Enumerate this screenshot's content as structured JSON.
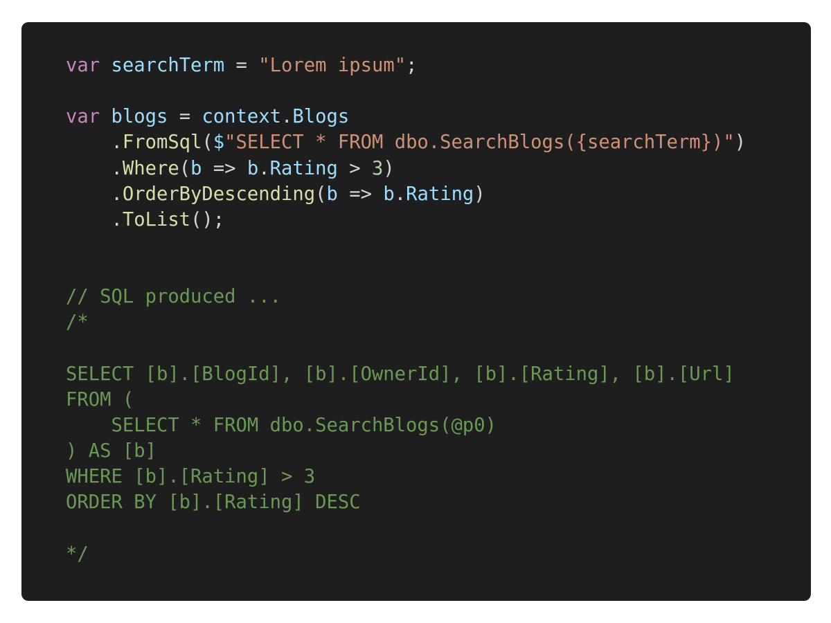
{
  "colors": {
    "background": "#1e1e1e",
    "page": "#ffffff",
    "keyword": "#c586c0",
    "variable": "#9cdcfe",
    "function": "#dcdcaa",
    "string": "#ce9178",
    "number": "#b5cea8",
    "plain": "#d4d4d4",
    "comment": "#6a9955"
  },
  "code": {
    "lines": [
      [
        {
          "type": "keyword",
          "text": "var"
        },
        {
          "type": "plain",
          "text": " "
        },
        {
          "type": "variable",
          "text": "searchTerm"
        },
        {
          "type": "plain",
          "text": " = "
        },
        {
          "type": "string",
          "text": "\"Lorem ipsum\""
        },
        {
          "type": "plain",
          "text": ";"
        }
      ],
      [],
      [
        {
          "type": "keyword",
          "text": "var"
        },
        {
          "type": "plain",
          "text": " "
        },
        {
          "type": "variable",
          "text": "blogs"
        },
        {
          "type": "plain",
          "text": " = "
        },
        {
          "type": "variable",
          "text": "context"
        },
        {
          "type": "plain",
          "text": "."
        },
        {
          "type": "variable",
          "text": "Blogs"
        }
      ],
      [
        {
          "type": "plain",
          "text": "    ."
        },
        {
          "type": "function",
          "text": "FromSql"
        },
        {
          "type": "plain",
          "text": "("
        },
        {
          "type": "variable",
          "text": "$"
        },
        {
          "type": "string",
          "text": "\"SELECT * FROM dbo.SearchBlogs({searchTerm})\""
        },
        {
          "type": "plain",
          "text": ")"
        }
      ],
      [
        {
          "type": "plain",
          "text": "    ."
        },
        {
          "type": "function",
          "text": "Where"
        },
        {
          "type": "plain",
          "text": "("
        },
        {
          "type": "variable",
          "text": "b"
        },
        {
          "type": "plain",
          "text": " => "
        },
        {
          "type": "variable",
          "text": "b"
        },
        {
          "type": "plain",
          "text": "."
        },
        {
          "type": "variable",
          "text": "Rating"
        },
        {
          "type": "plain",
          "text": " > "
        },
        {
          "type": "number",
          "text": "3"
        },
        {
          "type": "plain",
          "text": ")"
        }
      ],
      [
        {
          "type": "plain",
          "text": "    ."
        },
        {
          "type": "function",
          "text": "OrderByDescending"
        },
        {
          "type": "plain",
          "text": "("
        },
        {
          "type": "variable",
          "text": "b"
        },
        {
          "type": "plain",
          "text": " => "
        },
        {
          "type": "variable",
          "text": "b"
        },
        {
          "type": "plain",
          "text": "."
        },
        {
          "type": "variable",
          "text": "Rating"
        },
        {
          "type": "plain",
          "text": ")"
        }
      ],
      [
        {
          "type": "plain",
          "text": "    ."
        },
        {
          "type": "function",
          "text": "ToList"
        },
        {
          "type": "plain",
          "text": "();"
        }
      ],
      [],
      [],
      [
        {
          "type": "comment",
          "text": "// SQL produced ..."
        }
      ],
      [
        {
          "type": "comment",
          "text": "/*"
        }
      ],
      [],
      [
        {
          "type": "comment",
          "text": "SELECT [b].[BlogId], [b].[OwnerId], [b].[Rating], [b].[Url]"
        }
      ],
      [
        {
          "type": "comment",
          "text": "FROM ("
        }
      ],
      [
        {
          "type": "comment",
          "text": "    SELECT * FROM dbo.SearchBlogs(@p0)"
        }
      ],
      [
        {
          "type": "comment",
          "text": ") AS [b]"
        }
      ],
      [
        {
          "type": "comment",
          "text": "WHERE [b].[Rating] > 3"
        }
      ],
      [
        {
          "type": "comment",
          "text": "ORDER BY [b].[Rating] DESC"
        }
      ],
      [],
      [
        {
          "type": "comment",
          "text": "*/"
        }
      ]
    ]
  }
}
